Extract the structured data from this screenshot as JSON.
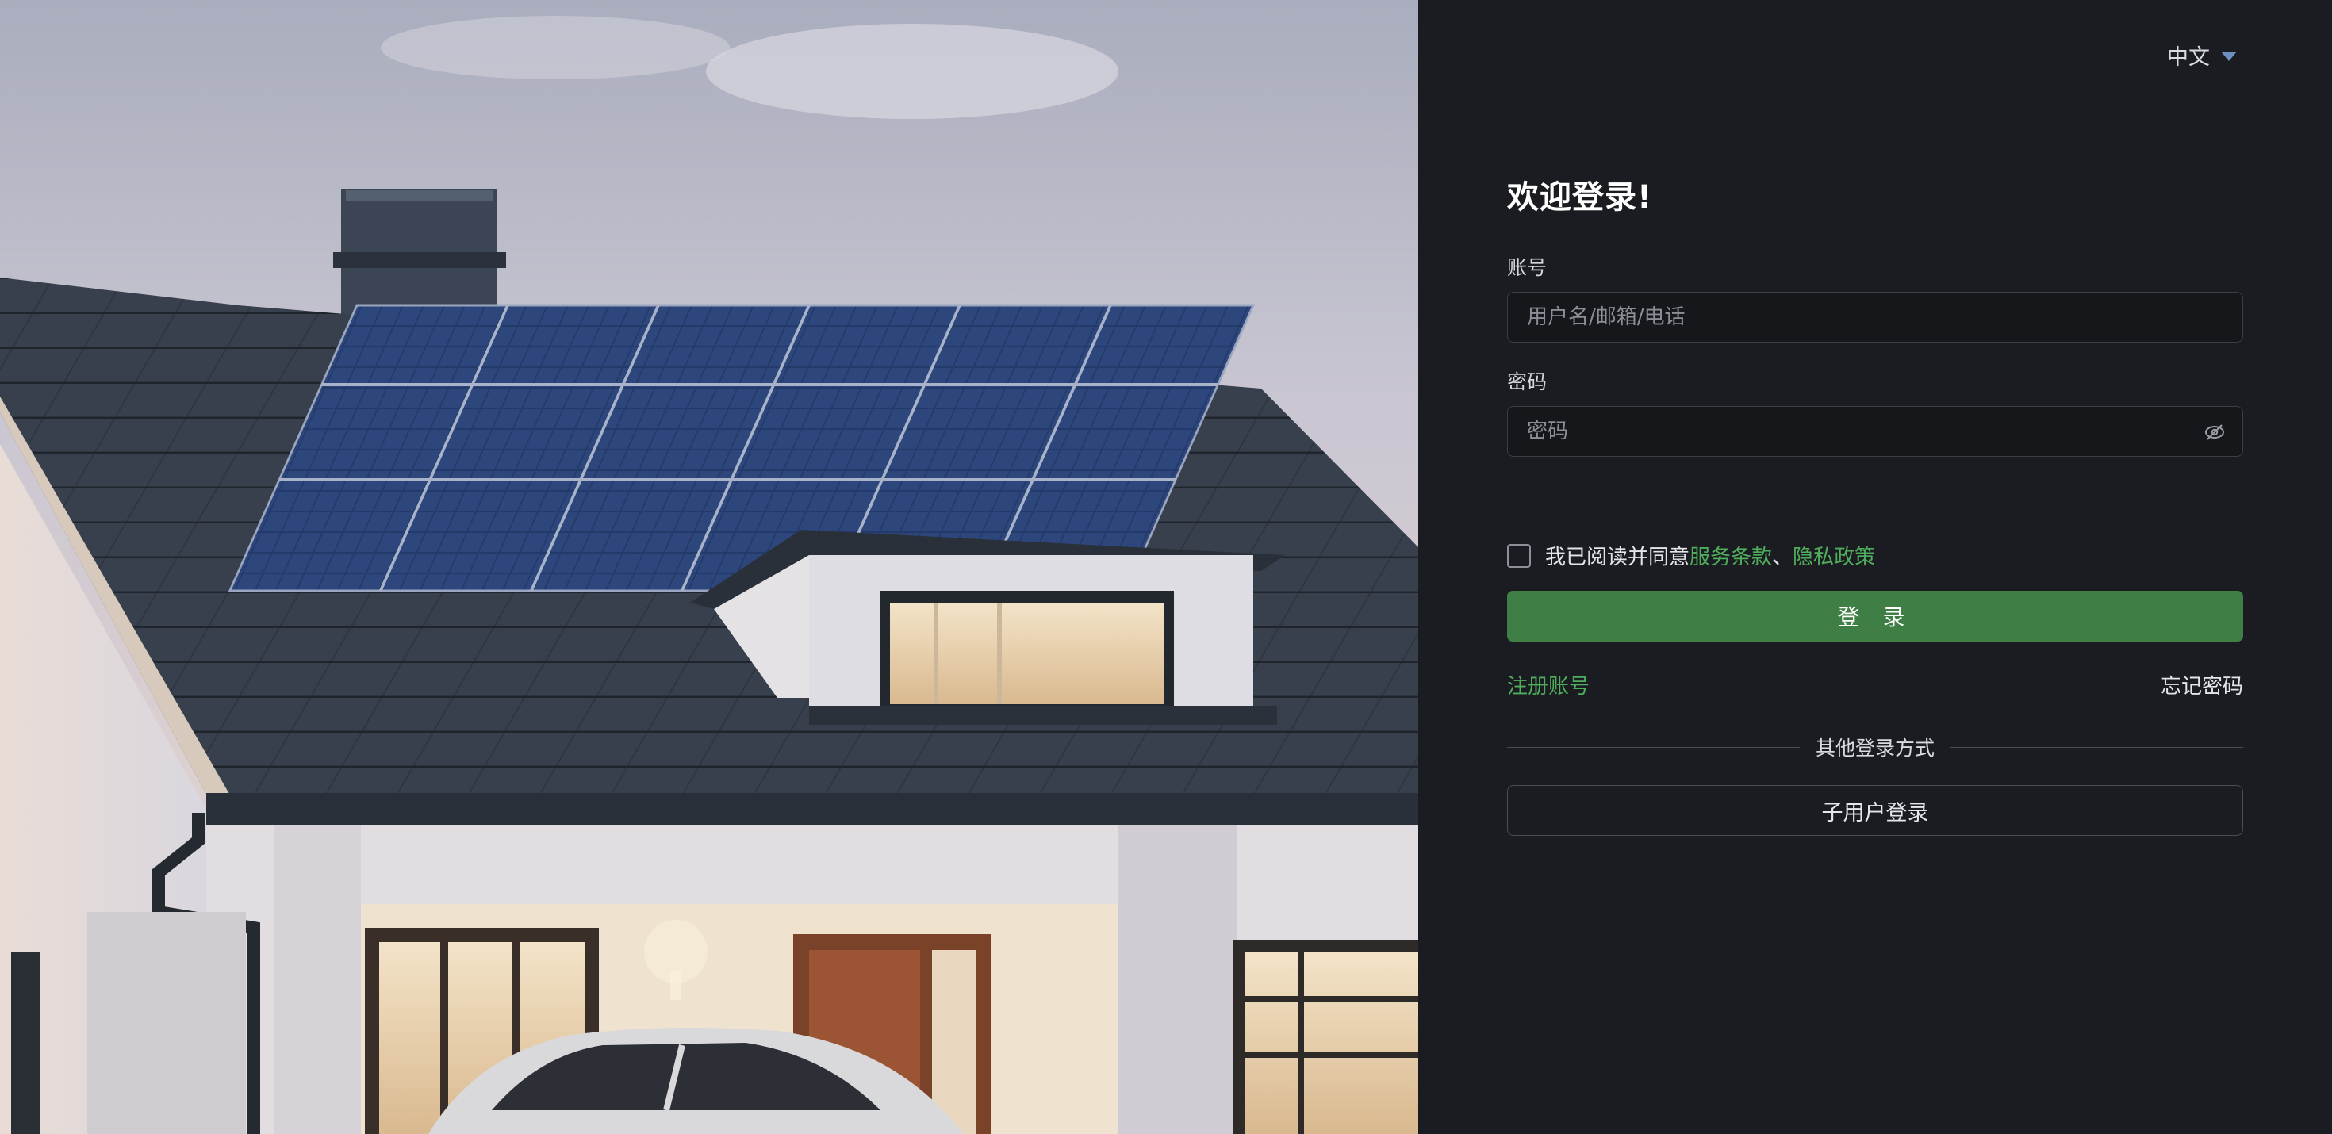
{
  "language": {
    "selected": "中文"
  },
  "login": {
    "title": "欢迎登录!",
    "account_label": "账号",
    "account_placeholder": "用户名/邮箱/电话",
    "password_label": "密码",
    "password_placeholder": "密码",
    "agreement_prefix": "我已阅读并同意",
    "terms_link": "服务条款",
    "separator": "、",
    "privacy_link": "隐私政策",
    "login_button": "登 录",
    "register_link": "注册账号",
    "forgot_link": "忘记密码",
    "other_methods": "其他登录方式",
    "sub_user_button": "子用户登录"
  },
  "colors": {
    "accent_green": "#4fae5c",
    "button_green": "#3f7f45",
    "panel_background": "#1b1c21"
  },
  "icons": [
    "caret-down-icon",
    "eye-off-icon"
  ]
}
